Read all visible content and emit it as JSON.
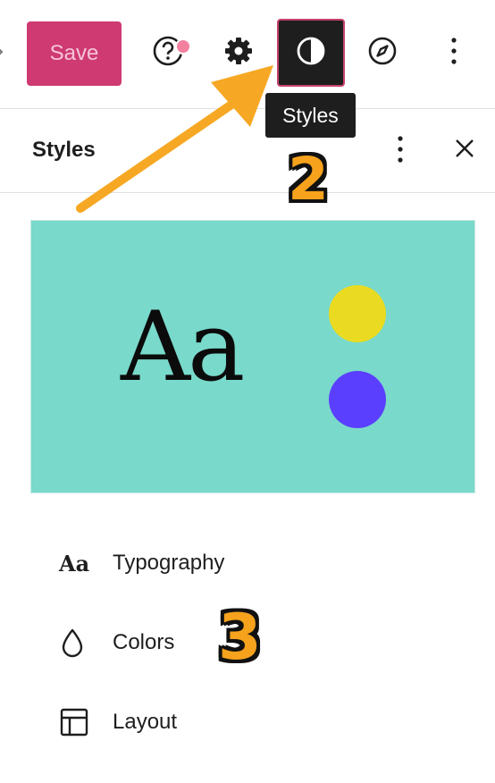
{
  "toolbar": {
    "save_label": "Save",
    "help_icon": "help-icon",
    "settings_icon": "gear-icon",
    "styles_icon": "half-circle-contrast-icon",
    "compass_icon": "compass-icon",
    "more_icon": "vertical-ellipsis-icon",
    "tooltip": "Styles"
  },
  "panel": {
    "title": "Styles",
    "more_icon": "vertical-ellipsis-icon",
    "close_icon": "close-icon"
  },
  "preview": {
    "sample_text": "Aa",
    "background_color": "#79d9cb",
    "dot_colors": [
      "#eadb22",
      "#5b3ffe"
    ]
  },
  "menu": {
    "items": [
      {
        "label": "Typography",
        "icon": "typography-icon",
        "icon_text": "Aa"
      },
      {
        "label": "Colors",
        "icon": "droplet-icon"
      },
      {
        "label": "Layout",
        "icon": "layout-icon"
      }
    ]
  },
  "annotations": {
    "step_2": "2",
    "step_3": "3",
    "arrow_color": "#f6a824"
  },
  "colors": {
    "save_bg": "#cf3a73",
    "styles_active_bg": "#1e1e1e",
    "styles_active_border": "#c8426b",
    "help_dot": "#f4809f"
  }
}
